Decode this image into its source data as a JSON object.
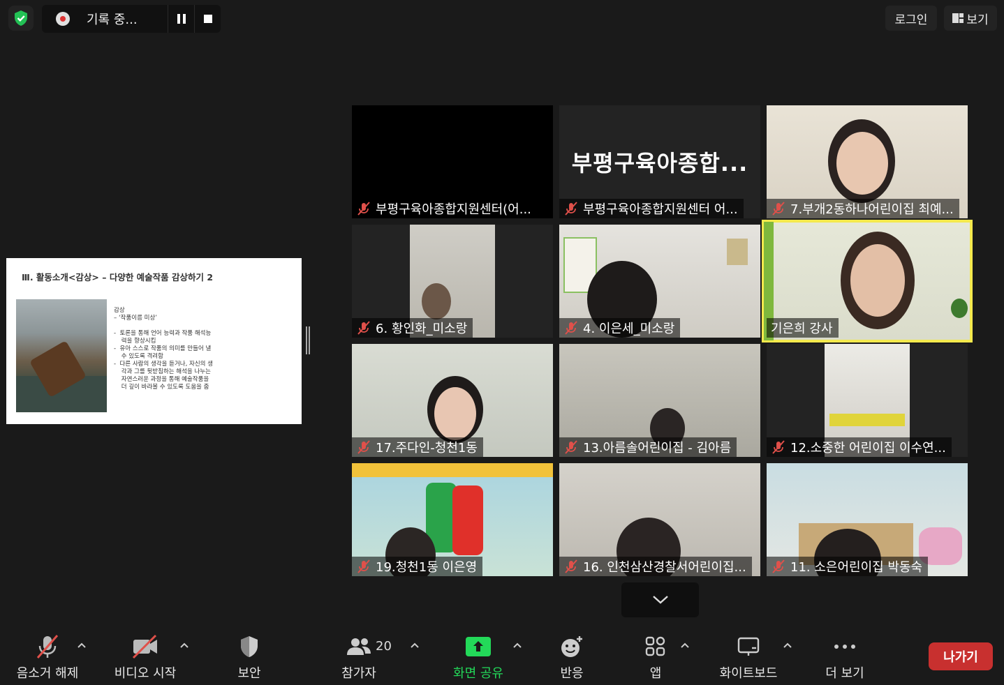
{
  "recording": {
    "label": "기록 중..."
  },
  "top_right": {
    "login": "로그인",
    "view": "보기"
  },
  "slide": {
    "title": "Ⅲ. 활동소개<감상> – 다양한 예술작품 감상하기 2",
    "body": "감상\n– ‘작품이름 미상’\n\n-  토론을 통해 언어 능력과 작품 해석능\n    력을 향상시킴\n-  유아 스스로 작품의 의미를 만들어 낼\n    수 있도록 격려함\n-  다른 사람의 생각을 듣거나, 자신의 생\n    각과 그를 뒷받침하는 해석을 나누는\n    자연스러운 과정을 통해 예술작품을\n    더 깊이 바라볼 수 있도록 도움을 줌"
  },
  "tiles": [
    {
      "name": "부평구육아종합지원센터(어...",
      "big": "",
      "muted": true
    },
    {
      "name": "부평구육아종합지원센터 어...",
      "big": "부평구육아종합...",
      "muted": true
    },
    {
      "name": "7.부개2동하나어린이집 최예...",
      "big": "",
      "muted": true
    },
    {
      "name": "6. 황인화_미소랑",
      "big": "",
      "muted": true
    },
    {
      "name": "4. 이은세_미소랑",
      "big": "",
      "muted": true
    },
    {
      "name": "기은희 강사",
      "big": "",
      "muted": false
    },
    {
      "name": "17.주다인-청천1동",
      "big": "",
      "muted": true
    },
    {
      "name": "13.아름솔어린이집 - 김아름",
      "big": "",
      "muted": true
    },
    {
      "name": "12.소중한 어린이집 이수연...",
      "big": "",
      "muted": true
    },
    {
      "name": "19.청천1동 이은영",
      "big": "",
      "muted": true
    },
    {
      "name": "16. 인천삼산경찰서어린이집...",
      "big": "",
      "muted": true
    },
    {
      "name": "11. 소은어린이집 박동숙",
      "big": "",
      "muted": true
    }
  ],
  "toolbar": {
    "unmute": "음소거 해제",
    "start_video": "비디오 시작",
    "security": "보안",
    "participants": "참가자",
    "participant_count": "20",
    "share_screen": "화면 공유",
    "reactions": "반응",
    "apps": "앱",
    "whiteboard": "화이트보드",
    "more": "더 보기",
    "leave": "나가기"
  },
  "colors": {
    "share_green": "#23d959",
    "leave_red": "#c8302f",
    "active_speaker": "#f4e94d",
    "mute_red": "#e0504a"
  }
}
